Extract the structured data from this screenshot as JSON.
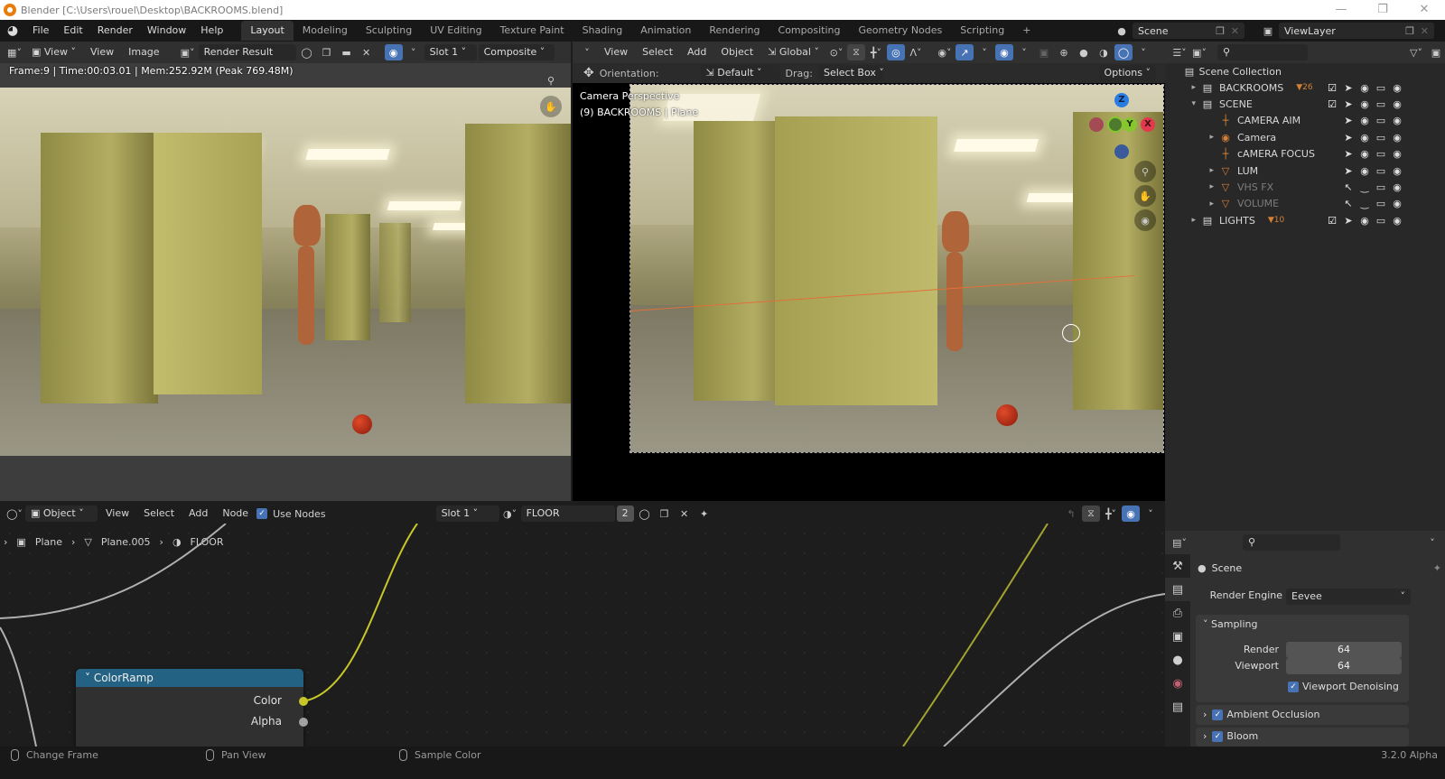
{
  "window": {
    "title": "Blender [C:\\Users\\rouel\\Desktop\\BACKROOMS.blend]",
    "controls": [
      "minimize-icon",
      "restore-icon",
      "close-icon"
    ]
  },
  "topbar": {
    "menus": [
      "File",
      "Edit",
      "Render",
      "Window",
      "Help"
    ],
    "workspaces": [
      "Layout",
      "Modeling",
      "Sculpting",
      "UV Editing",
      "Texture Paint",
      "Shading",
      "Animation",
      "Rendering",
      "Compositing",
      "Geometry Nodes",
      "Scripting"
    ],
    "active_workspace": "Layout",
    "add_workspace": "+",
    "scene": "Scene",
    "view_layer": "ViewLayer"
  },
  "image_editor": {
    "view_mode": "View",
    "menus": [
      "View",
      "Image"
    ],
    "image_name": "Render Result",
    "slot": "Slot 1",
    "layer": "Composite",
    "render_info": "Frame:9 | Time:00:03.01 | Mem:252.92M (Peak 769.48M)"
  },
  "viewport": {
    "menus": [
      "View",
      "Select",
      "Add",
      "Object"
    ],
    "transform_orientation": "Global",
    "tool_orientation_label": "Orientation:",
    "tool_orientation": "Default",
    "drag_label": "Drag:",
    "drag_value": "Select Box",
    "options_label": "Options",
    "overlay_title": "Camera Perspective",
    "overlay_subtitle": "(9) BACKROOMS | Plane",
    "gizmo_axes": [
      "Z",
      "Y",
      "X"
    ]
  },
  "outliner": {
    "root": "Scene Collection",
    "rows": [
      {
        "name": "BACKROOMS",
        "badge": "26",
        "indent": 0,
        "expand": "collapsed",
        "dim": false
      },
      {
        "name": "SCENE",
        "badge": "",
        "indent": 0,
        "expand": "expanded",
        "dim": false
      },
      {
        "name": "CAMERA AIM",
        "badge": "",
        "indent": 1,
        "expand": "none",
        "dim": false
      },
      {
        "name": "Camera",
        "badge": "",
        "indent": 1,
        "expand": "collapsed",
        "dim": false
      },
      {
        "name": "cAMERA FOCUS",
        "badge": "",
        "indent": 1,
        "expand": "none",
        "dim": false
      },
      {
        "name": "LUM",
        "badge": "",
        "indent": 1,
        "expand": "collapsed",
        "dim": false
      },
      {
        "name": "VHS FX",
        "badge": "",
        "indent": 1,
        "expand": "collapsed",
        "dim": true
      },
      {
        "name": "VOLUME",
        "badge": "",
        "indent": 1,
        "expand": "collapsed",
        "dim": true
      },
      {
        "name": "LIGHTS",
        "badge": "10",
        "indent": 0,
        "expand": "collapsed",
        "dim": false
      }
    ]
  },
  "node_editor": {
    "object_mode": "Object",
    "menus": [
      "View",
      "Select",
      "Add",
      "Node"
    ],
    "use_nodes_label": "Use Nodes",
    "use_nodes": true,
    "slot": "Slot 1",
    "material": "FLOOR",
    "material_users": "2",
    "breadcrumb": [
      "Plane",
      "Plane.005",
      "FLOOR"
    ],
    "node": {
      "title": "ColorRamp",
      "outputs": [
        "Color",
        "Alpha"
      ]
    }
  },
  "properties": {
    "context": "Scene",
    "render_engine_label": "Render Engine",
    "render_engine": "Eevee",
    "sampling": {
      "title": "Sampling",
      "render_label": "Render",
      "render": "64",
      "viewport_label": "Viewport",
      "viewport": "64",
      "denoise_label": "Viewport Denoising",
      "denoise": true
    },
    "panels": [
      {
        "title": "Ambient Occlusion",
        "enabled": true
      },
      {
        "title": "Bloom",
        "enabled": true
      }
    ]
  },
  "statusbar": {
    "hints": [
      "Change Frame",
      "Pan View",
      "Sample Color"
    ],
    "version": "3.2.0 Alpha"
  },
  "colors": {
    "accent": "#4772b3",
    "node_header": "#246283",
    "socket_color": "#c7c729",
    "socket_alpha": "#a1a1a1",
    "x_axis": "#e2394e",
    "y_axis": "#86c62f",
    "z_axis": "#2a7de0"
  }
}
